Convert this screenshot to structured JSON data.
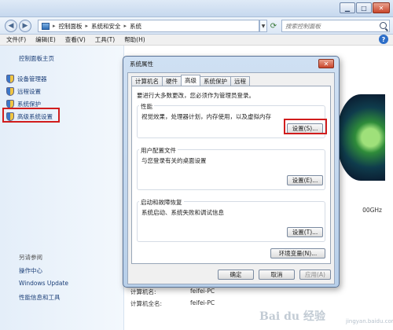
{
  "breadcrumb": [
    "控制面板",
    "系统和安全",
    "系统"
  ],
  "search": {
    "placeholder": "搜索控制面板"
  },
  "menu": [
    "文件(F)",
    "编辑(E)",
    "查看(V)",
    "工具(T)",
    "帮助(H)"
  ],
  "left_nav": {
    "home": "控制面板主页",
    "links": [
      "设备管理器",
      "远程设置",
      "系统保护",
      "高级系统设置"
    ],
    "highlighted_link": "高级系统设置",
    "see_also_title": "另请参阅",
    "see_also": [
      "操作中心",
      "Windows Update",
      "性能信息和工具"
    ]
  },
  "right_pane": {
    "side_text": "00GHz",
    "rows": [
      {
        "label": "计算机名:",
        "value": "feifei-PC"
      },
      {
        "label": "计算机全名:",
        "value": "feifei-PC"
      }
    ]
  },
  "dialog": {
    "title": "系统属性",
    "tabs": [
      "计算机名",
      "硬件",
      "高级",
      "系统保护",
      "远程"
    ],
    "active_tab": "高级",
    "admin_note": "要进行大多数更改，您必须作为管理员登录。",
    "groups": [
      {
        "title": "性能",
        "description": "视觉效果，处理器计划，内存使用，以及虚拟内存",
        "button": "设置(S)..."
      },
      {
        "title": "用户配置文件",
        "description": "与您登录有关的桌面设置",
        "button": "设置(E)..."
      },
      {
        "title": "启动和故障恢复",
        "description": "系统启动、系统失败和调试信息",
        "button": "设置(T)..."
      }
    ],
    "env_button": "环境变量(N)...",
    "ok": "确定",
    "cancel": "取消",
    "apply": "应用(A)"
  },
  "watermark": {
    "main": "Bai du 经验",
    "sub": "jingyan.baidu.com"
  },
  "colors": {
    "highlight": "#d11d1d",
    "link": "#1c3f78",
    "titlebar": "#c6d8ee"
  }
}
